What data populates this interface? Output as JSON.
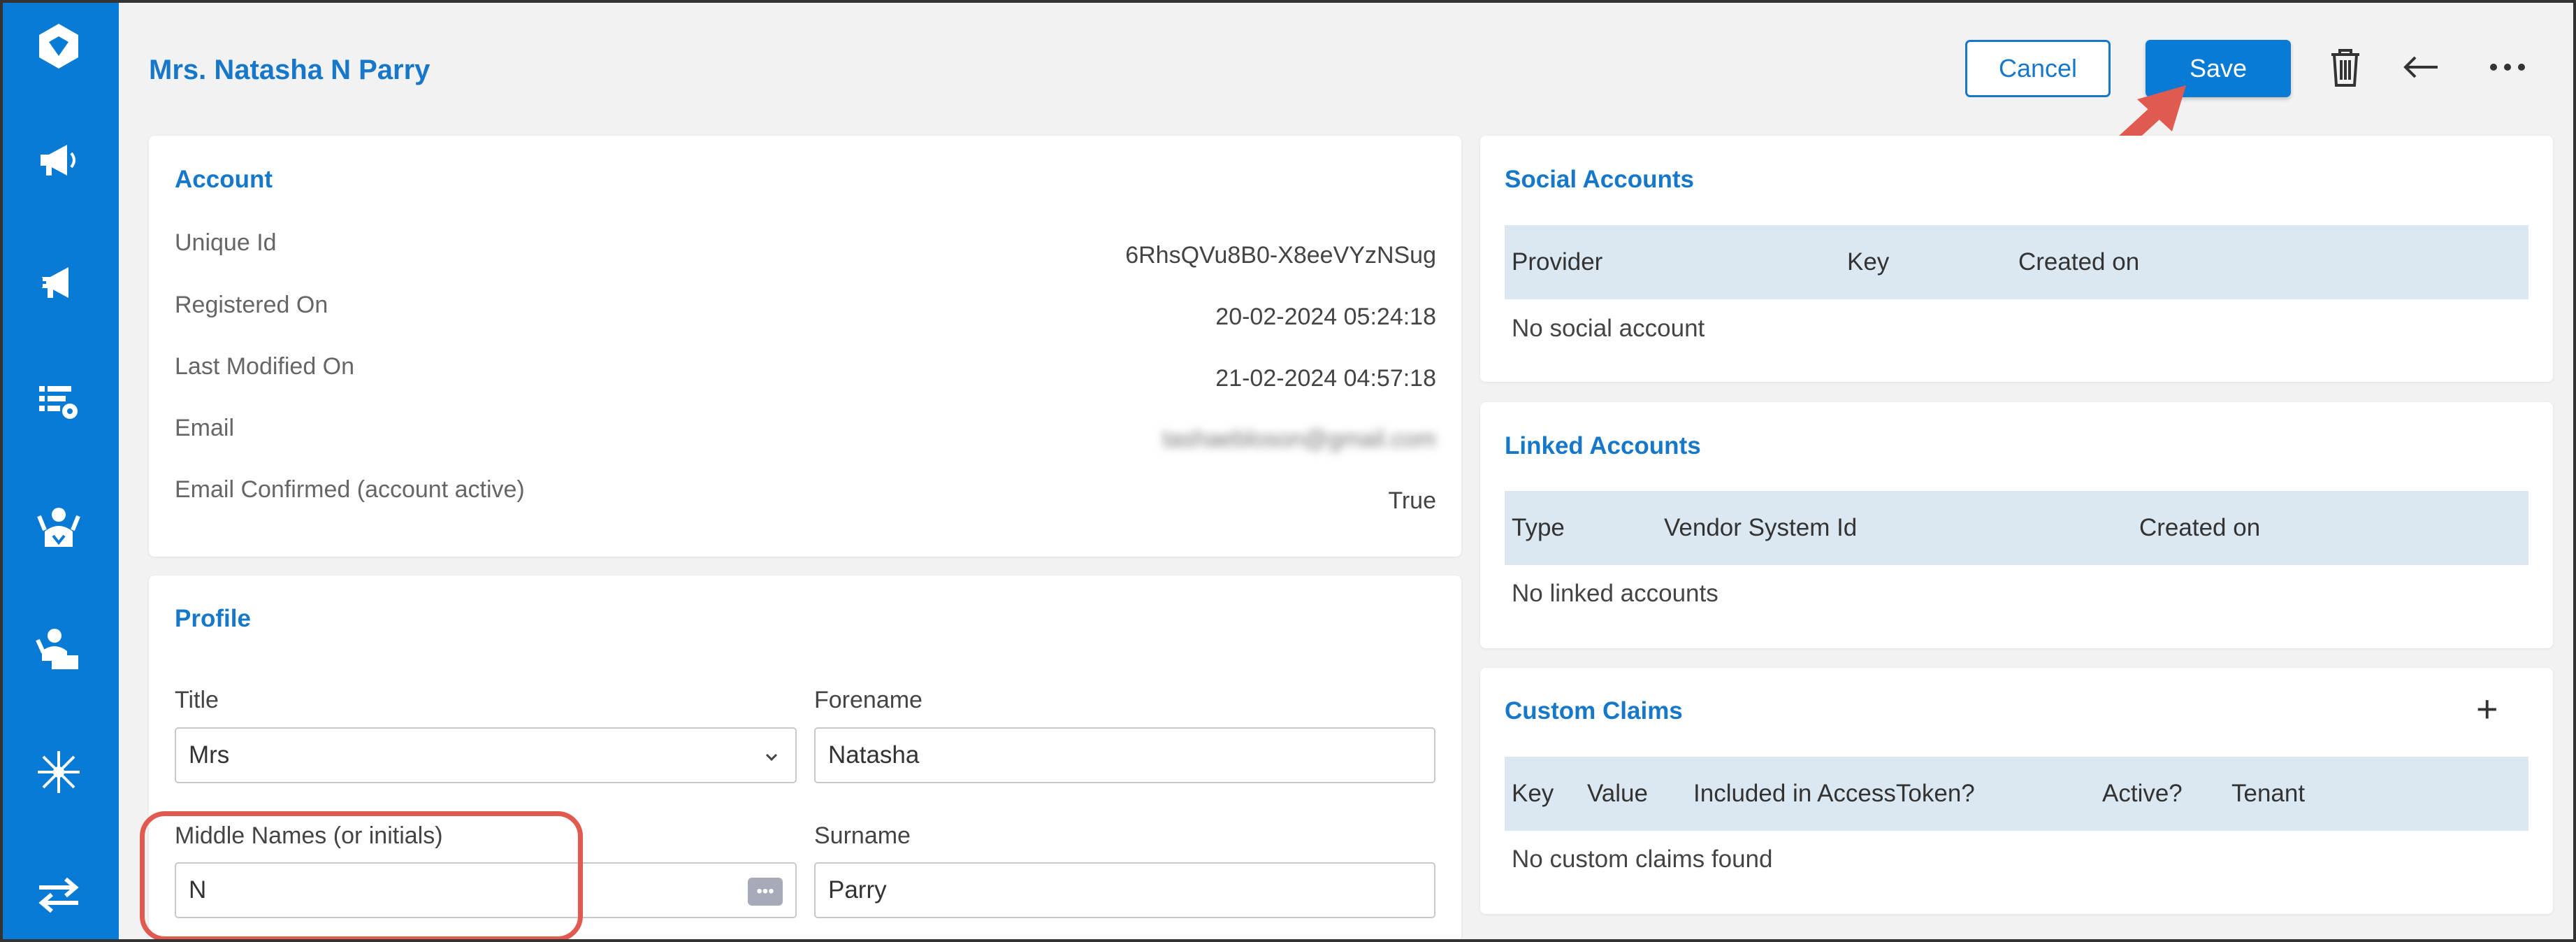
{
  "header": {
    "title": "Mrs. Natasha N Parry",
    "cancel_label": "Cancel",
    "save_label": "Save"
  },
  "sidebar": {
    "icons": [
      "app-logo-icon",
      "megaphone-icon",
      "megaphone-plus-icon",
      "list-settings-icon",
      "user-support-icon",
      "user-desk-icon",
      "snowflake-grid-icon",
      "transfer-arrows-icon"
    ]
  },
  "account": {
    "title": "Account",
    "rows": [
      {
        "label": "Unique Id",
        "value": "6RhsQVu8B0-X8eeVYzNSug"
      },
      {
        "label": "Registered On",
        "value": "20-02-2024 05:24:18"
      },
      {
        "label": "Last Modified On",
        "value": "21-02-2024 04:57:18"
      },
      {
        "label": "Email",
        "value": "tashaebloson@gmail.com"
      },
      {
        "label": "Email Confirmed (account active)",
        "value": "True"
      }
    ]
  },
  "profile": {
    "title": "Profile",
    "title_label": "Title",
    "title_value": "Mrs",
    "forename_label": "Forename",
    "forename_value": "Natasha",
    "middle_label": "Middle Names (or initials)",
    "middle_value": "N",
    "surname_label": "Surname",
    "surname_value": "Parry"
  },
  "social": {
    "title": "Social Accounts",
    "columns": [
      "Provider",
      "Key",
      "Created on"
    ],
    "empty": "No social account"
  },
  "linked": {
    "title": "Linked Accounts",
    "columns": [
      "Type",
      "Vendor System Id",
      "Created on"
    ],
    "empty": "No linked accounts"
  },
  "claims": {
    "title": "Custom Claims",
    "add_label": "+",
    "columns": [
      "Key",
      "Value",
      "Included in AccessToken?",
      "Active?",
      "Tenant"
    ],
    "empty": "No custom claims found"
  },
  "colors": {
    "sidebar": "#0a7bd5",
    "accent": "#1778c9",
    "annotation": "#e05a4f",
    "table_header": "#dce8f1"
  }
}
